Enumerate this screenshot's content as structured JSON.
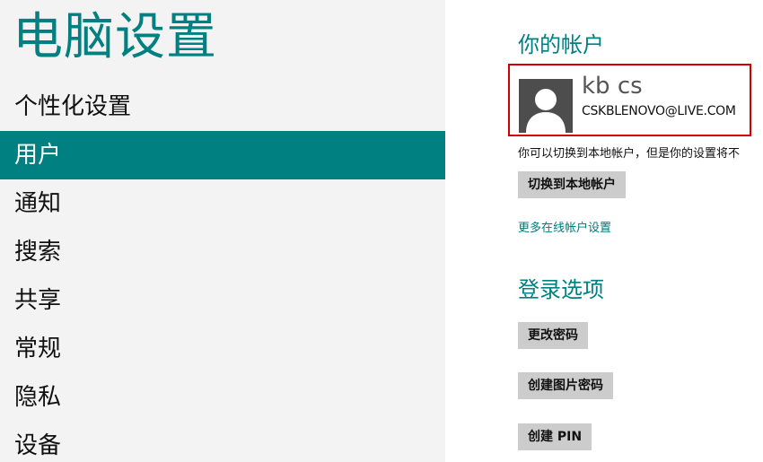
{
  "app": {
    "title": "电脑设置"
  },
  "nav": {
    "items": [
      {
        "label": "个性化设置"
      },
      {
        "label": "用户"
      },
      {
        "label": "通知"
      },
      {
        "label": "搜索"
      },
      {
        "label": "共享"
      },
      {
        "label": "常规"
      },
      {
        "label": "隐私"
      },
      {
        "label": "设备"
      }
    ],
    "active": "用户"
  },
  "account": {
    "section_title": "你的帐户",
    "user_name": "kb cs",
    "email": "CSKBLENOVO@LIVE.COM",
    "avatar_icon": "user-silhouette-icon",
    "info_text": "你可以切换到本地帐户，但是你的设置将不",
    "switch_button": "切换到本地帐户",
    "more_link": "更多在线帐户设置"
  },
  "signin": {
    "section_title": "登录选项",
    "change_password": "更改密码",
    "picture_password": "创建图片密码",
    "create_pin": "创建 PIN"
  },
  "colors": {
    "accent": "#008080",
    "sidebar_bg": "#f3f3f3",
    "button_bg": "#cccccc",
    "highlight_border": "#d40000"
  }
}
